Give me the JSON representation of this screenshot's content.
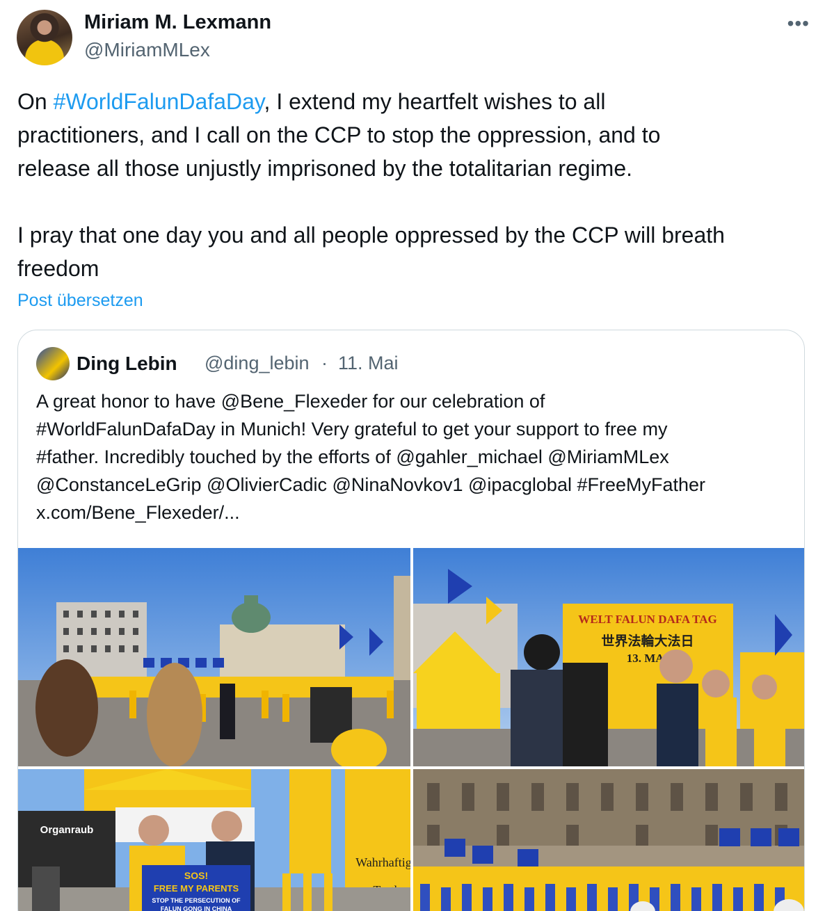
{
  "author": {
    "name": "Miriam M. Lexmann",
    "handle": "@MiriamMLex"
  },
  "more_icon": "more-horizontal-icon",
  "post": {
    "prefix": "On ",
    "hashtag": "#WorldFalunDafaDay",
    "line1_rest": ", I extend my heartfelt wishes to all",
    "line2": "practitioners, and I call on the CCP to stop the oppression, and to",
    "line3": "release all those unjustly imprisoned by the totalitarian regime.",
    "line4": "I pray that one day you and all people oppressed by the CCP will breath",
    "line5": "freedom"
  },
  "translate_label": "Post übersetzen",
  "quote": {
    "name": "Ding Lebin",
    "handle": "@ding_lebin",
    "separator": "·",
    "date": "11. Mai",
    "lines": [
      "A great honor to have @Bene_Flexeder for our celebration of",
      "#WorldFalunDafaDay in Munich! Very grateful to get your support to free my",
      "#father. Incredibly touched by the efforts of @gahler_michael @MiriamMLex",
      "@ConstanceLeGrip @OlivierCadic @NinaNovkov1 @ipacglobal #FreeMyFather",
      "x.com/Bene_Flexeder/..."
    ]
  },
  "media": {
    "photo2_banner_line1": "WELT FALUN DAFA TAG",
    "photo2_banner_line2": "世界法輪大法日",
    "photo2_banner_line3": "13. MAI",
    "photo3_sign_line1": "SOS!",
    "photo3_sign_line2": "FREE MY PARENTS",
    "photo3_sign_line3": "STOP THE PERSECUTION OF",
    "photo3_sign_line4": "FALUN GONG IN CHINA",
    "photo3_banner": "Organraub",
    "photo3_flag": "Wahrhaftigk",
    "photo3_flag2": "Truth"
  },
  "colors": {
    "link": "#1d9bf0",
    "text": "#0f1419",
    "secondary": "#536471",
    "border": "#cfd9de",
    "falun_yellow": "#f5c518",
    "eu_blue": "#1f3fb0"
  }
}
